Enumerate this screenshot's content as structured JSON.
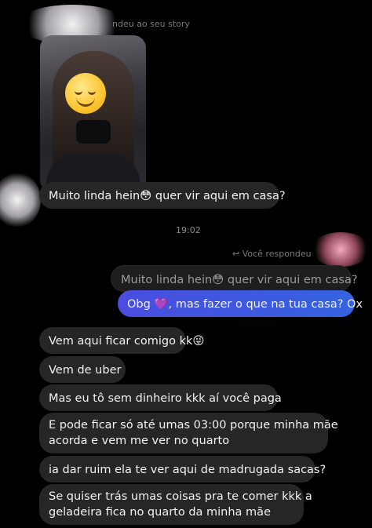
{
  "story_reply": {
    "header": "ndeu ao seu story"
  },
  "story_emoji": "😌",
  "messages_top": {
    "msg1": "Muito linda hein😳 quer vir aqui em casa?"
  },
  "timestamp": "19:02",
  "you_replied": {
    "label": "Você respondeu",
    "quoted": "Muito linda hein😳 quer vir aqui em casa?",
    "reply": "Obg 💜, mas fazer o que na tua casa? Ox"
  },
  "messages": [
    "Vem aqui ficar comigo kk😜",
    "Vem de uber",
    "Mas eu tô sem dinheiro kkk aí você paga",
    "E pode ficar só até umas 03:00 porque minha mãe",
    "acorda e vem me ver no quarto",
    "ia dar ruim ela te ver aqui de madrugada sacas?",
    "Se quiser trás umas coisas pra te comer kkk a",
    "geladeira fica no quarto da minha mãe"
  ],
  "colors": {
    "background": "#000000",
    "incoming_bubble": "#262626",
    "outgoing_bubble": "#3b5bdb",
    "quoted_bubble": "#1e1e1e"
  }
}
